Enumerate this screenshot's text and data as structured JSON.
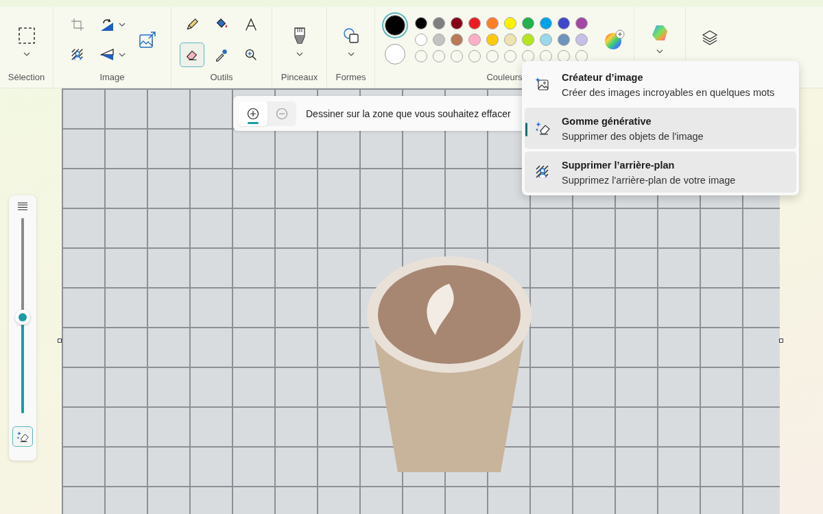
{
  "toolbar": {
    "selection": {
      "label": "Sélection"
    },
    "image": {
      "label": "Image"
    },
    "tools": {
      "label": "Outils",
      "items": [
        {
          "selected": false
        },
        {
          "selected": false
        },
        {
          "selected": false
        },
        {
          "selected": true
        },
        {
          "selected": false
        },
        {
          "selected": false
        }
      ]
    },
    "brushes": {
      "label": "Pinceaux"
    },
    "shapes": {
      "label": "Formes"
    },
    "colors": {
      "label": "Couleurs",
      "primary": {
        "color": "#000000",
        "selected": true
      },
      "secondary": {
        "color": "#ffffff",
        "selected": false
      },
      "palette": [
        {
          "color": "#000000"
        },
        {
          "color": "#7f7f7f"
        },
        {
          "color": "#880015"
        },
        {
          "color": "#ed1c24"
        },
        {
          "color": "#ff7f27"
        },
        {
          "color": "#fff200"
        },
        {
          "color": "#22b14c"
        },
        {
          "color": "#00a2e8"
        },
        {
          "color": "#3f48cc"
        },
        {
          "color": "#a349a4"
        },
        {
          "color": "#ffffff"
        },
        {
          "color": "#c3c3c3"
        },
        {
          "color": "#b97a57"
        },
        {
          "color": "#ffaec9"
        },
        {
          "color": "#ffc90e"
        },
        {
          "color": "#efe4b0"
        },
        {
          "color": "#b5e61d"
        },
        {
          "color": "#99d9ea"
        },
        {
          "color": "#7092be"
        },
        {
          "color": "#c8bfe7"
        }
      ]
    }
  },
  "hint_bar": {
    "modes": [
      {
        "selected": true
      },
      {
        "selected": false
      }
    ],
    "text": "Dessiner sur la zone que vous souhaitez effacer"
  },
  "brush_size": {
    "level": 0.49
  },
  "menu": {
    "items": [
      {
        "title": "Créateur d’image",
        "description": "Créer des images incroyables en quelques mots",
        "selected": false,
        "highlighted": false
      },
      {
        "title": "Gomme générative",
        "description": "Supprimer des objets de l'image",
        "selected": true,
        "highlighted": true
      },
      {
        "title": "Supprimer l’arrière-plan",
        "description": "Supprimez l'arrière-plan de votre image",
        "selected": false,
        "highlighted": true
      }
    ]
  }
}
